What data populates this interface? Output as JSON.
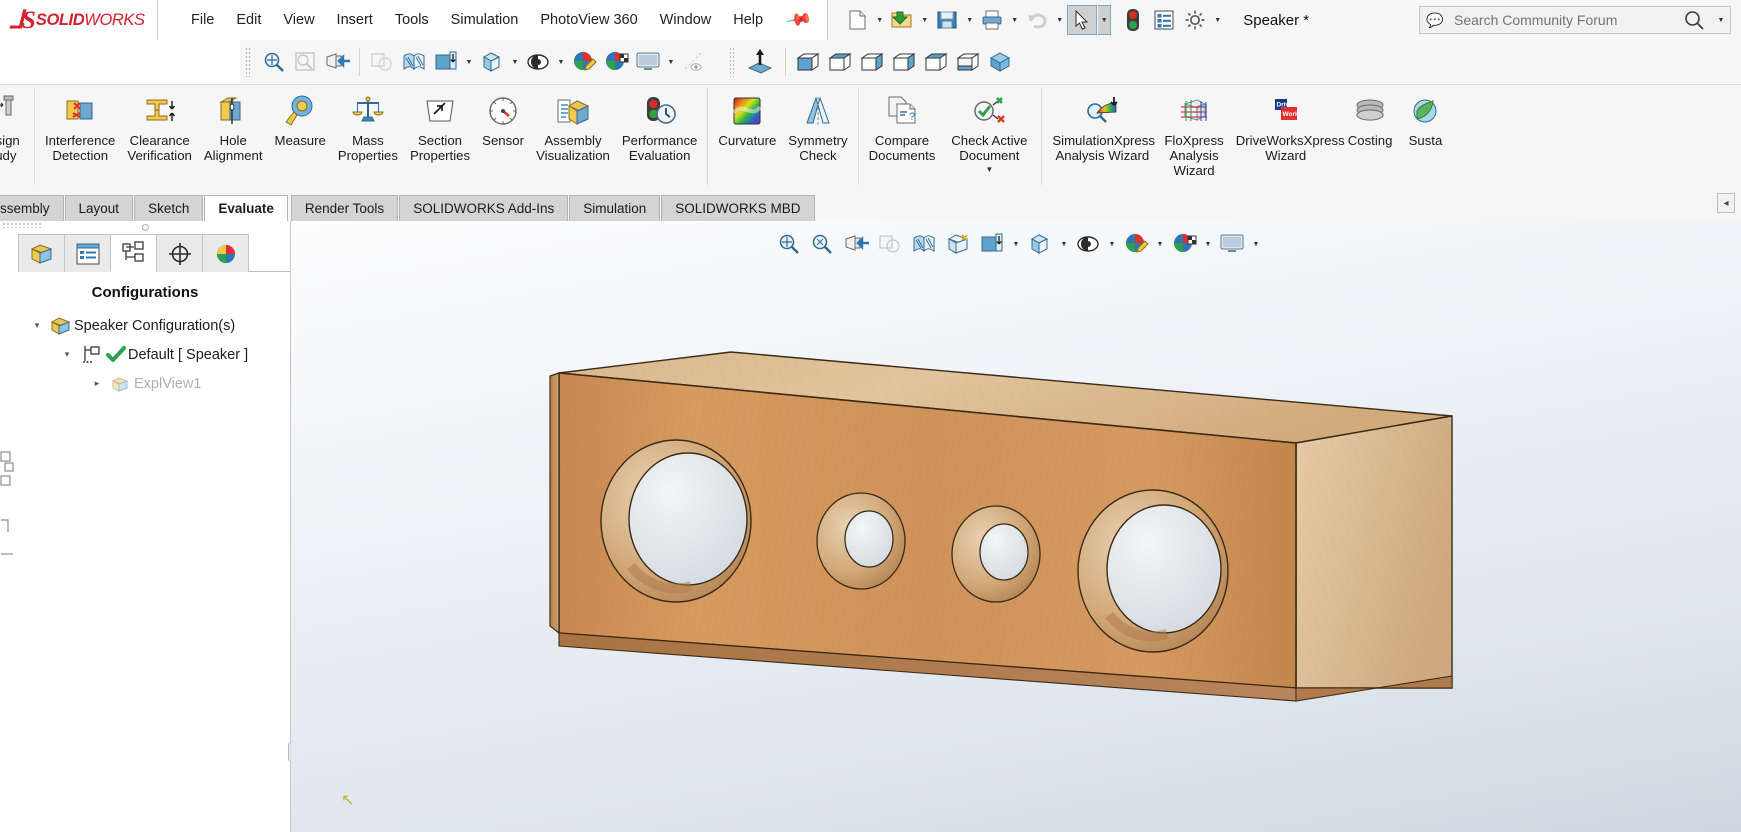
{
  "app": {
    "brand_mark": "2S",
    "brand_solid": "SOLID",
    "brand_works": "WORKS",
    "document_title": "Speaker *",
    "accent_red": "#d5202d",
    "accent_blue": "#2e77b5"
  },
  "menu": {
    "items": [
      {
        "label": "File"
      },
      {
        "label": "Edit"
      },
      {
        "label": "View"
      },
      {
        "label": "Insert"
      },
      {
        "label": "Tools"
      },
      {
        "label": "Simulation"
      },
      {
        "label": "PhotoView 360"
      },
      {
        "label": "Window"
      },
      {
        "label": "Help"
      }
    ],
    "pin_icon": "pushpin-icon"
  },
  "quick_access": {
    "buttons": [
      {
        "name": "new-document",
        "icon": "new-file-icon",
        "caret": true
      },
      {
        "name": "open-document",
        "icon": "open-folder-icon",
        "caret": true
      },
      {
        "name": "save-document",
        "icon": "save-floppy-icon",
        "caret": true
      },
      {
        "name": "print-document",
        "icon": "printer-icon",
        "caret": true
      },
      {
        "name": "undo",
        "icon": "undo-arrow-icon",
        "caret": true
      },
      {
        "name": "select",
        "icon": "cursor-arrow-icon",
        "caret": true,
        "selected": true
      },
      {
        "name": "rebuild",
        "icon": "traffic-light-icon",
        "caret": false
      },
      {
        "name": "options-list",
        "icon": "list-properties-icon",
        "caret": false
      },
      {
        "name": "options",
        "icon": "gear-icon",
        "caret": true
      }
    ]
  },
  "search": {
    "placeholder": "Search Community Forum",
    "bubble_icon": "chat-bubble-icon",
    "magnifier_icon": "magnifier-icon",
    "caret_icon": "chevron-down-icon"
  },
  "toolbar2": {
    "group1": [
      {
        "name": "zoom-to-area",
        "icon": "zoom-pan-icon"
      },
      {
        "name": "zoom-to-fit",
        "icon": "zoom-fit-icon",
        "disabled": true
      },
      {
        "name": "view-orientation-flashlight",
        "icon": "flashlight-icon"
      }
    ],
    "group2": [
      {
        "name": "rotate-view",
        "icon": "rotate-view-icon",
        "disabled": true
      },
      {
        "name": "section-view",
        "icon": "section-view-icon"
      },
      {
        "name": "apply-scene",
        "icon": "apply-scene-icon",
        "caret": true
      },
      {
        "name": "display-style",
        "icon": "display-style-cube-icon",
        "caret": true
      },
      {
        "name": "hide-show-items",
        "icon": "eye-icon",
        "caret": true
      },
      {
        "name": "edit-appearance",
        "icon": "appearance-sphere-icon"
      },
      {
        "name": "edit-scene",
        "icon": "scene-sphere-icon"
      },
      {
        "name": "view-settings",
        "icon": "monitor-icon",
        "caret": true
      },
      {
        "name": "view-sketches",
        "icon": "hidden-eye-icon",
        "disabled": true
      }
    ],
    "group3": [
      {
        "name": "normal-to",
        "icon": "normal-to-icon"
      },
      {
        "name": "front-view",
        "icon": "cube-front-icon"
      },
      {
        "name": "back-view",
        "icon": "cube-back-icon"
      },
      {
        "name": "left-view",
        "icon": "cube-left-icon"
      },
      {
        "name": "right-view",
        "icon": "cube-right-icon"
      },
      {
        "name": "top-view",
        "icon": "cube-top-icon"
      },
      {
        "name": "bottom-view",
        "icon": "cube-bottom-icon"
      },
      {
        "name": "isometric-view",
        "icon": "cube-iso-icon"
      }
    ]
  },
  "ribbon": {
    "items": [
      {
        "id": "design-study",
        "label": "Design\nStudy",
        "icon": "design-study-icon",
        "partial": true
      },
      {
        "sep": true
      },
      {
        "id": "interference-detection",
        "label": "Interference\nDetection",
        "icon": "interference-detection-icon"
      },
      {
        "id": "clearance-verification",
        "label": "Clearance\nVerification",
        "icon": "clearance-verification-icon"
      },
      {
        "id": "hole-alignment",
        "label": "Hole\nAlignment",
        "icon": "hole-alignment-icon"
      },
      {
        "id": "measure",
        "label": "Measure",
        "icon": "measure-tape-icon"
      },
      {
        "id": "mass-properties",
        "label": "Mass\nProperties",
        "icon": "mass-properties-scale-icon"
      },
      {
        "id": "section-properties",
        "label": "Section\nProperties",
        "icon": "section-properties-icon"
      },
      {
        "id": "sensor",
        "label": "Sensor",
        "icon": "sensor-gauge-icon"
      },
      {
        "id": "assembly-visualization",
        "label": "Assembly\nVisualization",
        "icon": "assembly-visualization-icon"
      },
      {
        "id": "performance-evaluation",
        "label": "Performance\nEvaluation",
        "icon": "performance-evaluation-icon"
      },
      {
        "sep": true
      },
      {
        "id": "curvature",
        "label": "Curvature",
        "icon": "curvature-rainbow-icon"
      },
      {
        "id": "symmetry-check",
        "label": "Symmetry\nCheck",
        "icon": "symmetry-check-icon"
      },
      {
        "sep": true
      },
      {
        "id": "compare-documents",
        "label": "Compare\nDocuments",
        "icon": "compare-documents-icon"
      },
      {
        "id": "check-active-document",
        "label": "Check Active\nDocument",
        "icon": "check-active-document-icon",
        "dropdown": true
      },
      {
        "sep": true
      },
      {
        "id": "simulationxpress",
        "label": "SimulationXpress\nAnalysis Wizard",
        "icon": "simulationxpress-icon"
      },
      {
        "id": "floxpress",
        "label": "FloXpress\nAnalysis\nWizard",
        "icon": "floxpress-icon"
      },
      {
        "id": "driveworksxpress",
        "label": "DriveWorksXpress\nWizard",
        "icon": "driveworks-icon"
      },
      {
        "id": "costing",
        "label": "Costing",
        "icon": "costing-coins-icon"
      },
      {
        "id": "sustainability",
        "label": "Susta",
        "icon": "sustainability-icon",
        "partial": true
      }
    ]
  },
  "command_tabs": {
    "items": [
      {
        "id": "assembly",
        "label": "ssembly",
        "active": false,
        "clipped": true
      },
      {
        "id": "layout",
        "label": "Layout",
        "active": false
      },
      {
        "id": "sketch",
        "label": "Sketch",
        "active": false
      },
      {
        "id": "evaluate",
        "label": "Evaluate",
        "active": true
      },
      {
        "id": "render-tools",
        "label": "Render Tools",
        "active": false
      },
      {
        "id": "solidworks-add-ins",
        "label": "SOLIDWORKS Add-Ins",
        "active": false
      },
      {
        "id": "simulation",
        "label": "Simulation",
        "active": false
      },
      {
        "id": "solidworks-mbd",
        "label": "SOLIDWORKS MBD",
        "active": false
      }
    ],
    "collapse_icon": "collapse-ribbon-icon"
  },
  "panel": {
    "tabs": [
      {
        "id": "feature-manager",
        "icon": "feature-tree-icon",
        "active": false
      },
      {
        "id": "property-manager",
        "icon": "property-manager-icon",
        "active": false
      },
      {
        "id": "configuration-manager",
        "icon": "configuration-manager-icon",
        "active": true
      },
      {
        "id": "dimxpert-manager",
        "icon": "dimxpert-target-icon",
        "active": false
      },
      {
        "id": "display-manager",
        "icon": "display-manager-sphere-icon",
        "active": false
      }
    ],
    "title": "Configurations",
    "tree": [
      {
        "level": 0,
        "twist": "▾",
        "icon": "assembly-config-icon",
        "label": "Speaker Configuration(s)",
        "dim": false
      },
      {
        "level": 1,
        "twist": "▾",
        "icon": "configuration-icon",
        "check": true,
        "label": "Default [ Speaker ]",
        "dim": false
      },
      {
        "level": 2,
        "twist": "▸",
        "icon": "exploded-view-icon",
        "label": "ExplView1",
        "dim": true
      }
    ]
  },
  "viewport": {
    "toolbar": [
      {
        "name": "zoom-to-area",
        "icon": "zoom-pan-icon"
      },
      {
        "name": "zoom-to-fit",
        "icon": "zoom-fit-icon"
      },
      {
        "name": "previous-view",
        "icon": "flashlight-icon"
      },
      {
        "name": "rotate-view",
        "icon": "rotate-view-icon"
      },
      {
        "name": "section-view",
        "icon": "section-view-icon"
      },
      {
        "name": "view-orientation",
        "icon": "view-orientation-icon"
      },
      {
        "name": "apply-scene",
        "icon": "apply-scene-icon",
        "caret": true
      },
      {
        "name": "display-style",
        "icon": "display-style-cube-icon",
        "caret": true
      },
      {
        "name": "hide-show-items",
        "icon": "eye-icon",
        "caret": true
      },
      {
        "name": "edit-appearance",
        "icon": "appearance-sphere-icon",
        "caret": true
      },
      {
        "name": "edit-scene",
        "icon": "scene-sphere-icon",
        "caret": true
      },
      {
        "name": "view-settings",
        "icon": "monitor-icon",
        "caret": true
      }
    ],
    "model": {
      "name": "speaker-enclosure",
      "material": "wood",
      "wood_light": "#e0bb8d",
      "wood_mid": "#cf9b63",
      "wood_dark": "#b8804c",
      "wood_top": "#ddbd93",
      "edge_color": "#3a2a18",
      "holes": 4
    },
    "origin_label": "origin-marker"
  }
}
